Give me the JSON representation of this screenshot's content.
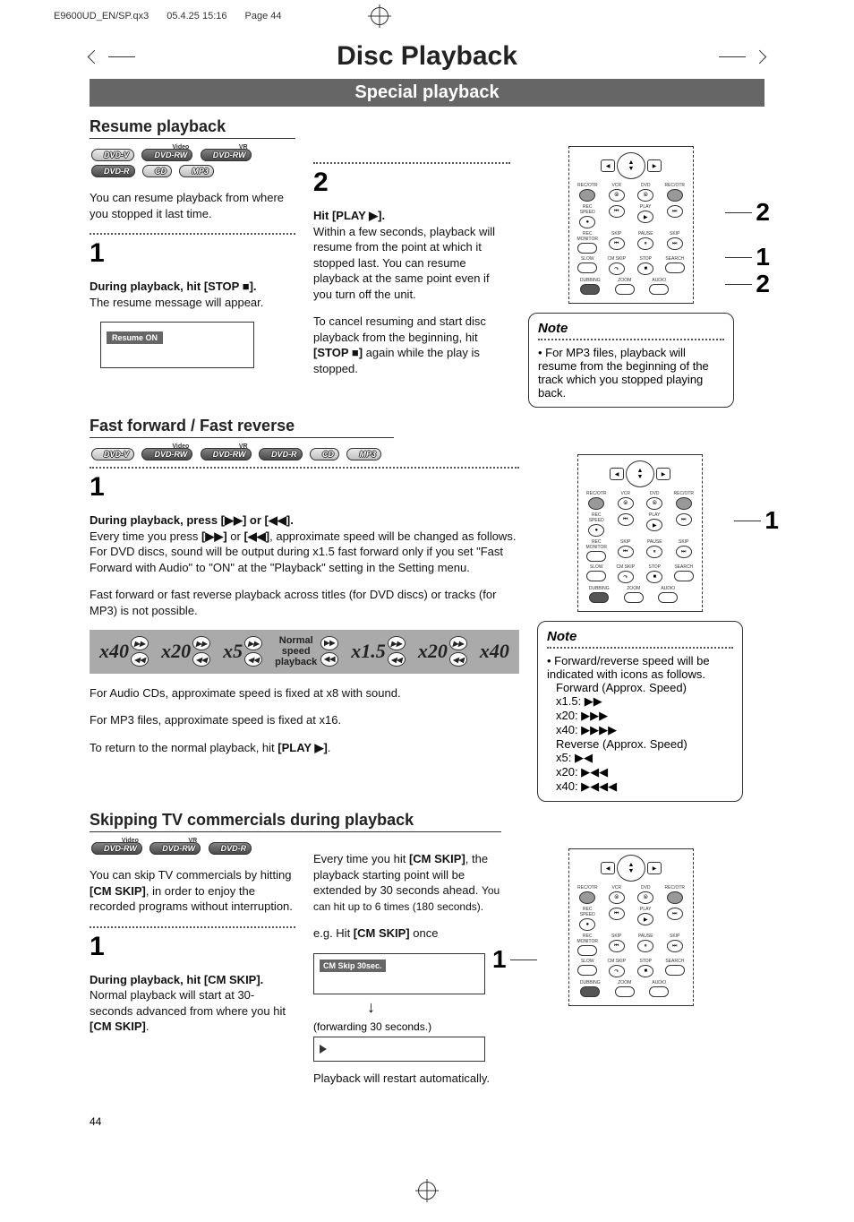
{
  "header": {
    "filename": "E9600UD_EN/SP.qx3",
    "timestamp": "05.4.25 15:16",
    "pageinfo": "Page 44"
  },
  "title": "Disc Playback",
  "subtitle": "Special playback",
  "resume": {
    "heading": "Resume playback",
    "badges_row1": [
      "DVD-V",
      "DVD-RW",
      "DVD-RW"
    ],
    "badges_sup1": [
      "",
      "Video",
      "VR"
    ],
    "badges_row2": [
      "DVD-R",
      "CD",
      "MP3"
    ],
    "intro": "You can resume playback from where you stopped it last time.",
    "step1_num": "1",
    "step1_bold": "During playback, hit [STOP ■].",
    "step1_text": "The resume message will appear.",
    "resume_on": "Resume ON",
    "step2_num": "2",
    "step2_bold": "Hit [PLAY ▶].",
    "step2_text": "Within a few seconds, playback will resume from the point at which it stopped last. You can resume playback at the same point even if you turn off the unit.",
    "step2_text2a": "To cancel resuming and start disc playback from the beginning, hit ",
    "step2_text2b": "[STOP ■]",
    "step2_text2c": " again while the play is stopped."
  },
  "note1": {
    "title": "Note",
    "text": "• For MP3 files, playback will resume from the beginning of the track which you stopped playing back."
  },
  "fastforward": {
    "heading": "Fast forward / Fast reverse",
    "badges": [
      "DVD-V",
      "DVD-RW",
      "DVD-RW",
      "DVD-R",
      "CD",
      "MP3"
    ],
    "badges_sup": [
      "",
      "Video",
      "VR",
      "",
      "",
      ""
    ],
    "step1_num": "1",
    "step1_bold": "During playback, press [▶▶] or [◀◀].",
    "para1a": "Every time you press ",
    "para1b": "[▶▶]",
    "para1c": " or ",
    "para1d": "[◀◀]",
    "para1e": ", approximate speed will be changed as follows. For DVD discs, sound will be output during x1.5 fast forward only if you set \"Fast Forward with Audio\" to \"ON\" at the \"Playback\" setting in the Setting menu.",
    "para2": "Fast forward or fast reverse playback across titles (for DVD discs) or tracks (for MP3) is not possible.",
    "speeds": [
      "x40",
      "x20",
      "x5",
      "Normal speed playback",
      "x1.5",
      "x20",
      "x40"
    ],
    "para3": "For Audio CDs, approximate speed is fixed at x8 with sound.",
    "para4": "For MP3 files, approximate speed is fixed at x16.",
    "para5a": "To return to the normal playback, hit ",
    "para5b": "[PLAY ▶]",
    "para5c": "."
  },
  "note2": {
    "title": "Note",
    "line1": "• Forward/reverse speed will be indicated with icons as follows.",
    "line2": "Forward (Approx. Speed)",
    "f1": "x1.5: ▶▶",
    "f2": "x20: ▶▶▶",
    "f3": "x40: ▶▶▶▶",
    "line3": "Reverse (Approx. Speed)",
    "r1": "x5:  ▶◀",
    "r2": "x20: ▶◀◀",
    "r3": "x40: ▶◀◀◀"
  },
  "cmskip": {
    "heading": "Skipping TV commercials during playback",
    "badges": [
      "DVD-RW",
      "DVD-RW",
      "DVD-R"
    ],
    "badges_sup": [
      "Video",
      "VR",
      ""
    ],
    "intro1": "You can skip TV commercials by hitting ",
    "intro1b": "[CM SKIP]",
    "intro1c": ", in order to enjoy the recorded programs without interruption.",
    "step1_num": "1",
    "step1_bold": "During playback, hit [CM SKIP].",
    "step1_text1": "Normal playback will start at 30-seconds advanced from where you hit ",
    "step1_text1b": "[CM SKIP]",
    "step1_text1c": ".",
    "col2_p1a": "Every time you hit ",
    "col2_p1b": "[CM SKIP]",
    "col2_p1c": ", the playback starting point will be extended by 30 seconds ahead. ",
    "col2_p1d": "You can hit up to 6 times (180 seconds).",
    "col2_p2a": "e.g. Hit ",
    "col2_p2b": "[CM SKIP]",
    "col2_p2c": " once",
    "cm_label": "CM Skip  30sec.",
    "forward_label": "(forwarding 30 seconds.)",
    "restart": "Playback will restart automatically."
  },
  "remote_labels": {
    "row1": [
      "REC/OTR",
      "VCR",
      "DVD",
      "REC/OTR"
    ],
    "row2": [
      "REC SPEED",
      "",
      "PLAY",
      ""
    ],
    "row3": [
      "REC MONITOR",
      "SKIP",
      "PAUSE",
      "SKIP"
    ],
    "row4": [
      "SLOW",
      "CM SKIP",
      "STOP",
      "SEARCH"
    ],
    "row5": [
      "DUBBING",
      "ZOOM",
      "AUDIO",
      ""
    ]
  },
  "remote_callouts": {
    "r1_a": "2",
    "r1_b": "1",
    "r1_c": "2",
    "r2": "1",
    "r3": "1"
  },
  "page_number": "44"
}
